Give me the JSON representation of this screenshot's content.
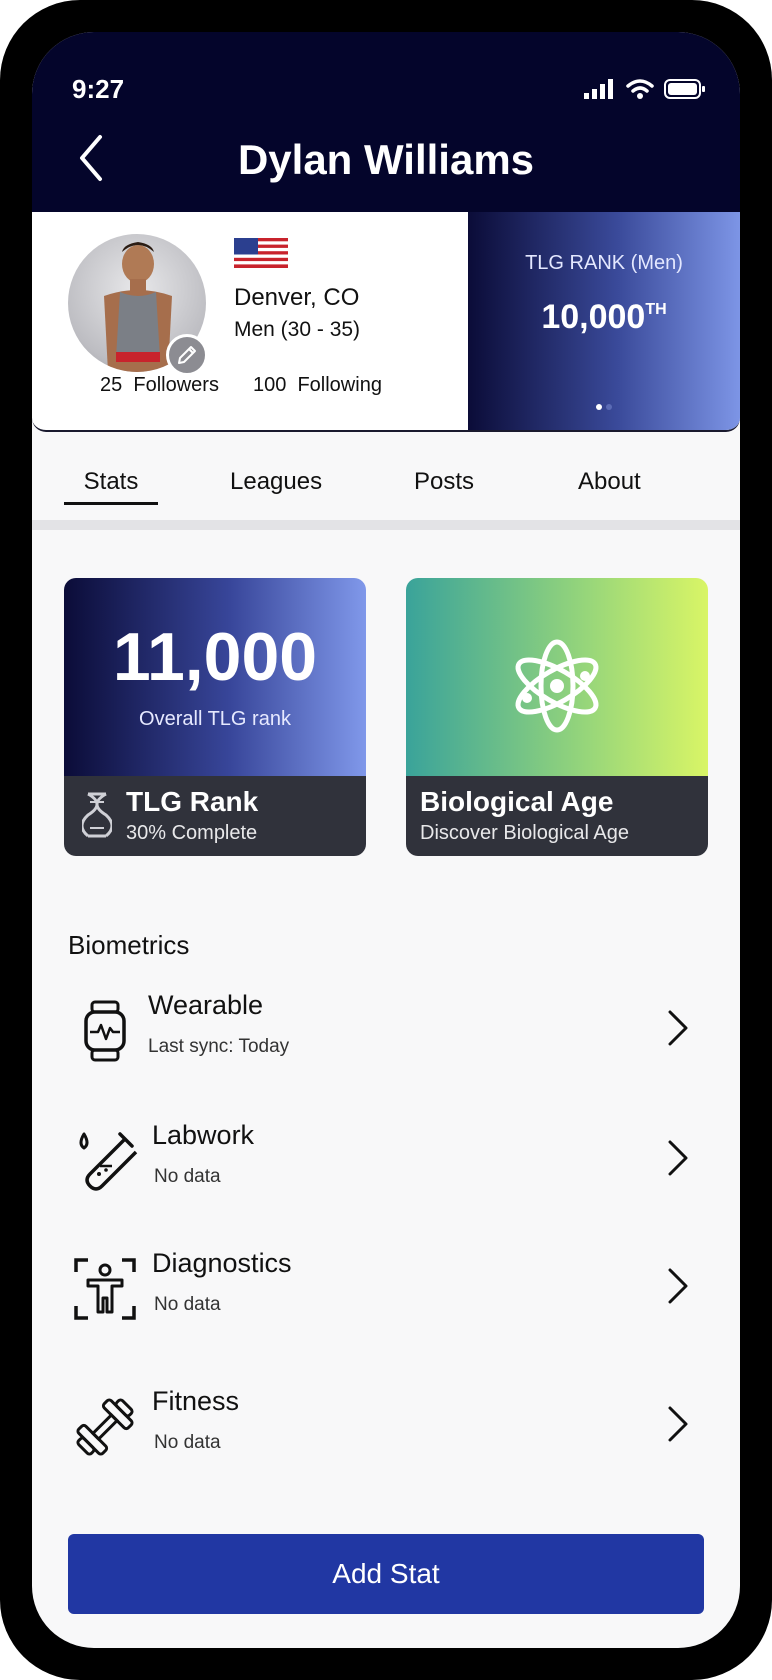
{
  "status_bar": {
    "time": "9:27"
  },
  "header": {
    "title": "Dylan Williams"
  },
  "profile": {
    "location": "Denver, CO",
    "demographic": "Men (30 - 35)",
    "followers_count": "25",
    "followers_label": "Followers",
    "following_count": "100",
    "following_label": "Following"
  },
  "rank_panel": {
    "label": "TLG RANK (Men)",
    "value": "10,000",
    "suffix": "TH"
  },
  "tabs": [
    {
      "label": "Stats"
    },
    {
      "label": "Leagues"
    },
    {
      "label": "Posts"
    },
    {
      "label": "About"
    }
  ],
  "cards": {
    "rank": {
      "big_value": "11,000",
      "big_caption": "Overall TLG rank",
      "title": "TLG Rank",
      "subtitle": "30% Complete"
    },
    "bio_age": {
      "title": "Biological Age",
      "subtitle": "Discover Biological Age"
    }
  },
  "biometrics": {
    "title": "Biometrics",
    "items": [
      {
        "label": "Wearable",
        "sub": "Last sync: Today",
        "icon": "smartwatch-icon"
      },
      {
        "label": "Labwork",
        "sub": "No data",
        "icon": "test-tube-icon"
      },
      {
        "label": "Diagnostics",
        "sub": "No data",
        "icon": "body-scan-icon"
      },
      {
        "label": "Fitness",
        "sub": "No data",
        "icon": "dumbbell-icon"
      }
    ]
  },
  "actions": {
    "add_stat_label": "Add Stat"
  },
  "colors": {
    "header_bg": "#04052b",
    "button_bg": "#2137a3",
    "card_footer_bg": "#30323b"
  }
}
